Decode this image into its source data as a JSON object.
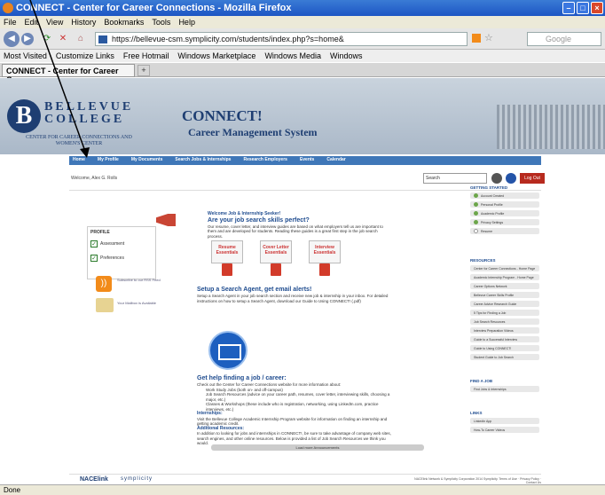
{
  "window": {
    "title": "CONNECT - Center for Career Connections - Mozilla Firefox"
  },
  "menu": [
    "File",
    "Edit",
    "View",
    "History",
    "Bookmarks",
    "Tools",
    "Help"
  ],
  "nav": {
    "url": "https://bellevue-csm.symplicity.com/students/index.php?s=home&",
    "search_placeholder": "Google"
  },
  "bookmarks": [
    "Most Visited",
    "Customize Links",
    "Free Hotmail",
    "Windows Marketplace",
    "Windows Media",
    "Windows"
  ],
  "tab": {
    "label": "CONNECT - Center for Career Co...",
    "new": "+"
  },
  "header": {
    "logo_letter": "B",
    "logo_text": "BELLEVUE COLLEGE",
    "logo_sub": "CENTER FOR CAREER CONNECTIONS AND WOMEN'S CENTER",
    "system_title": "CONNECT!",
    "system_subtitle": "Career Management System"
  },
  "sitenav": [
    "Home",
    "My Profile",
    "My Documents",
    "Search Jobs & Internships",
    "Research Employers",
    "Events",
    "Calendar"
  ],
  "welcome": "Welcome, Alex G. Rolls",
  "topsearch": "Search",
  "logout": "Log Out",
  "left": {
    "box_title": "PROFILE",
    "checks": [
      "Assessment",
      "Preferences"
    ],
    "rss_text": "Subscribe to our RSS Feed",
    "mail_text": "Your Mailbox is Available"
  },
  "center": {
    "intro_title": "Welcome Job & Internship Seeker!",
    "intro_q": "Are your job search skills perfect?",
    "intro_body": "Our resume, cover letter, and interview guides are based on what employers tell us are important to them and are developed for students. Reading these guides is a great first step in the job search process.",
    "docs": [
      "Resume Essentials",
      "Cover Letter Essentials",
      "Interview Essentials"
    ],
    "agent_title": "Setup a Search Agent, get email alerts!",
    "agent_body": "Setup a Search Agent in your job search section and receive new job & internship in your inbox. For detailed instructions on how to setup a Search Agent, download our Guide to Using CONNECT! (.pdf)",
    "help_title": "Get help finding a job / career:",
    "help_body": "Check out the Center for Career Connections website for more information about:",
    "help_items": [
      "Work Study Jobs (both on- and off-campus)",
      "Job Search Resources (advice on your career path, resumes, cover letter, interviewing skills, choosing a major, etc.)",
      "Classes & Workshops (these include who is registration, networking, using LinkedIn.com, practice interviews, etc.)"
    ],
    "intern_title": "Internships:",
    "intern_body": "Visit the Bellevue College Academic Internship Program website for information on finding an internship and getting academic credit.",
    "addl_title": "Additional Resources:",
    "addl_body": "In addition to looking for jobs and internships in CONNECT!, be sure to take advantage of company web sites, search engines, and other online resources. Below is provided a list of Job Search Resources we think you would.",
    "more_btn": "Load more Announcements"
  },
  "right": {
    "status_head": "GETTING STARTED",
    "status_items": [
      "Account Created",
      "Personal Profile",
      "Academic Profile",
      "Privacy Settings",
      "Resume"
    ],
    "resources_head": "RESOURCES",
    "resources": [
      "Center for Career Connections - Home Page",
      "Academic Internship Program - Home Page",
      "Career Options Network",
      "Bellevue Career Skills Profile",
      "Career Advice Research Guide",
      "5 Tips for Finding a Job",
      "Job Search Resources",
      "Interview Preparation Videos",
      "Guide to a Successful Interview",
      "Guide to Using CONNECT!",
      "Student Guide to Job Search"
    ],
    "find_head": "FIND A JOB",
    "find_items": [
      "Find Jobs & Internships"
    ],
    "links_head": "LINKS",
    "links": [
      "LinkedIn App",
      "How-To Career Videos"
    ]
  },
  "footer": {
    "nace": "NACElink",
    "symp": "symplicity",
    "copyright": "NACElink Network & Symplicity Corporation 2014 Symplicity. Terms of Use · Privacy Policy · Contact Us"
  },
  "status": "Done"
}
